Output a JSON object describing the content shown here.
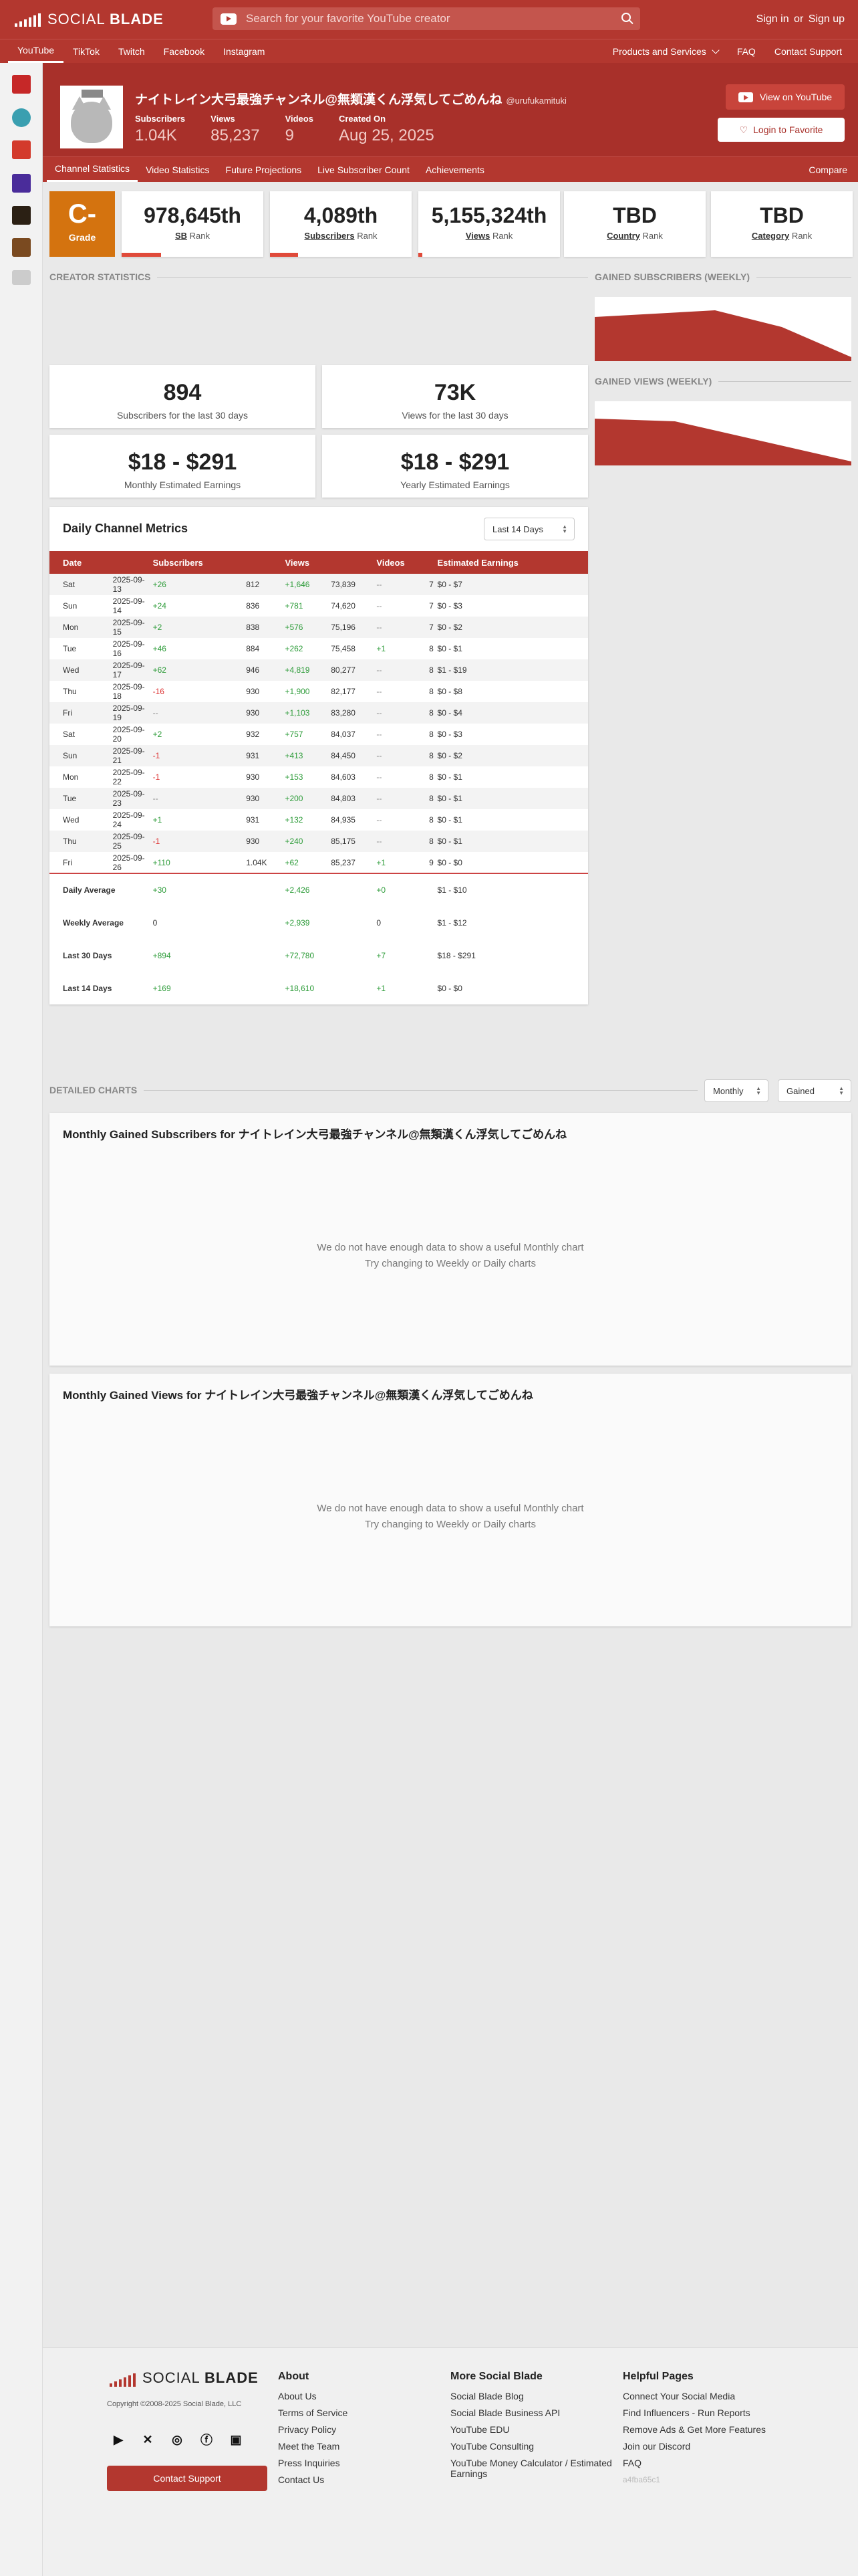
{
  "header": {
    "logo_text_1": "SOCIAL",
    "logo_text_2": "BLADE",
    "search_placeholder": "Search for your favorite YouTube creator",
    "sign_in": "Sign in",
    "or": "or",
    "sign_up": "Sign up"
  },
  "nav": {
    "platforms": [
      "YouTube",
      "TikTok",
      "Twitch",
      "Facebook",
      "Instagram"
    ],
    "products": "Products and Services",
    "faq": "FAQ",
    "contact": "Contact Support"
  },
  "channel": {
    "name": "ナイトレイン大弓最強チャンネル@無類漢くん浮気してごめんね",
    "handle": "@urufukamituki",
    "stats": [
      {
        "label": "Subscribers",
        "value": "1.04K"
      },
      {
        "label": "Views",
        "value": "85,237"
      },
      {
        "label": "Videos",
        "value": "9"
      },
      {
        "label": "Created On",
        "value": "Aug 25, 2025"
      }
    ],
    "view_button": "View on YouTube",
    "fav_button": "Login to Favorite"
  },
  "subnav": {
    "tabs": [
      "Channel Statistics",
      "Video Statistics",
      "Future Projections",
      "Live Subscriber Count",
      "Achievements"
    ],
    "compare": "Compare"
  },
  "grade": {
    "value": "C-",
    "label": "Grade"
  },
  "ranks": [
    {
      "value": "978,645th",
      "label": "SB",
      "suffix": "Rank",
      "fill": 0.28
    },
    {
      "value": "4,089th",
      "label": "Subscribers",
      "suffix": "Rank",
      "fill": 0.2
    },
    {
      "value": "5,155,324th",
      "label": "Views",
      "suffix": "Rank",
      "fill": 0.03
    },
    {
      "value": "TBD",
      "label": "Country",
      "suffix": "Rank",
      "fill": 0
    },
    {
      "value": "TBD",
      "label": "Category",
      "suffix": "Rank",
      "fill": 0
    }
  ],
  "sections": {
    "creator": "CREATOR STATISTICS",
    "gained_subs": "GAINED SUBSCRIBERS (WEEKLY)",
    "gained_views": "GAINED VIEWS (WEEKLY)",
    "detailed": "DETAILED CHARTS"
  },
  "summary": [
    {
      "value": "894",
      "label": "Subscribers for the last 30 days"
    },
    {
      "value": "73K",
      "label": "Views for the last 30 days"
    },
    {
      "value": "$18 - $291",
      "label": "Monthly Estimated Earnings"
    },
    {
      "value": "$18 - $291",
      "label": "Yearly Estimated Earnings"
    }
  ],
  "metrics": {
    "title": "Daily Channel Metrics",
    "range": "Last 14 Days",
    "columns": [
      "Date",
      "Subscribers",
      "Views",
      "Videos",
      "Estimated Earnings"
    ],
    "rows": [
      [
        "Sat",
        "2025-09-13",
        "+26",
        "812",
        "+1,646",
        "73,839",
        "--",
        "7",
        "$0 - $7"
      ],
      [
        "Sun",
        "2025-09-14",
        "+24",
        "836",
        "+781",
        "74,620",
        "--",
        "7",
        "$0 - $3"
      ],
      [
        "Mon",
        "2025-09-15",
        "+2",
        "838",
        "+576",
        "75,196",
        "--",
        "7",
        "$0 - $2"
      ],
      [
        "Tue",
        "2025-09-16",
        "+46",
        "884",
        "+262",
        "75,458",
        "+1",
        "8",
        "$0 - $1"
      ],
      [
        "Wed",
        "2025-09-17",
        "+62",
        "946",
        "+4,819",
        "80,277",
        "--",
        "8",
        "$1 - $19"
      ],
      [
        "Thu",
        "2025-09-18",
        "-16",
        "930",
        "+1,900",
        "82,177",
        "--",
        "8",
        "$0 - $8"
      ],
      [
        "Fri",
        "2025-09-19",
        "--",
        "930",
        "+1,103",
        "83,280",
        "--",
        "8",
        "$0 - $4"
      ],
      [
        "Sat",
        "2025-09-20",
        "+2",
        "932",
        "+757",
        "84,037",
        "--",
        "8",
        "$0 - $3"
      ],
      [
        "Sun",
        "2025-09-21",
        "-1",
        "931",
        "+413",
        "84,450",
        "--",
        "8",
        "$0 - $2"
      ],
      [
        "Mon",
        "2025-09-22",
        "-1",
        "930",
        "+153",
        "84,603",
        "--",
        "8",
        "$0 - $1"
      ],
      [
        "Tue",
        "2025-09-23",
        "--",
        "930",
        "+200",
        "84,803",
        "--",
        "8",
        "$0 - $1"
      ],
      [
        "Wed",
        "2025-09-24",
        "+1",
        "931",
        "+132",
        "84,935",
        "--",
        "8",
        "$0 - $1"
      ],
      [
        "Thu",
        "2025-09-25",
        "-1",
        "930",
        "+240",
        "85,175",
        "--",
        "8",
        "$0 - $1"
      ],
      [
        "Fri",
        "2025-09-26",
        "+110",
        "1.04K",
        "+62",
        "85,237",
        "+1",
        "9",
        "$0 - $0"
      ]
    ],
    "averages": [
      [
        "Daily Average",
        "+30",
        "+2,426",
        "+0",
        "$1 - $10"
      ],
      [
        "Weekly Average",
        "0",
        "+2,939",
        "0",
        "$1 - $12"
      ],
      [
        "Last 30 Days",
        "+894",
        "+72,780",
        "+7",
        "$18 - $291"
      ],
      [
        "Last 14 Days",
        "+169",
        "+18,610",
        "+1",
        "$0 - $0"
      ]
    ]
  },
  "detailed": {
    "period": "Monthly",
    "metric": "Gained",
    "charts": [
      {
        "title": "Monthly Gained Subscribers for ナイトレイン大弓最強チャンネル@無類漢くん浮気してごめんね"
      },
      {
        "title": "Monthly Gained Views for ナイトレイン大弓最強チャンネル@無類漢くん浮気してごめんね"
      }
    ],
    "empty_1": "We do not have enough data to show a useful Monthly chart",
    "empty_2": "Try changing to Weekly or Daily charts"
  },
  "footer": {
    "copyright": "Copyright ©2008-2025 Social Blade, LLC",
    "support_button": "Contact Support",
    "about": {
      "title": "About",
      "links": [
        "About Us",
        "Terms of Service",
        "Privacy Policy",
        "Meet the Team",
        "Press Inquiries",
        "Contact Us"
      ]
    },
    "more": {
      "title": "More Social Blade",
      "links": [
        "Social Blade Blog",
        "Social Blade Business API",
        "YouTube EDU",
        "YouTube Consulting",
        "YouTube Money Calculator / Estimated Earnings"
      ]
    },
    "help": {
      "title": "Helpful Pages",
      "links": [
        "Connect Your Social Media",
        "Find Influencers - Run Reports",
        "Remove Ads & Get More Features",
        "Join our Discord",
        "FAQ"
      ]
    },
    "hash": "a4fba65c1"
  },
  "colors": {
    "brand": "#b3372f",
    "grade": "#d4730f",
    "positive": "#2e9c3a",
    "negative": "#d33333"
  }
}
